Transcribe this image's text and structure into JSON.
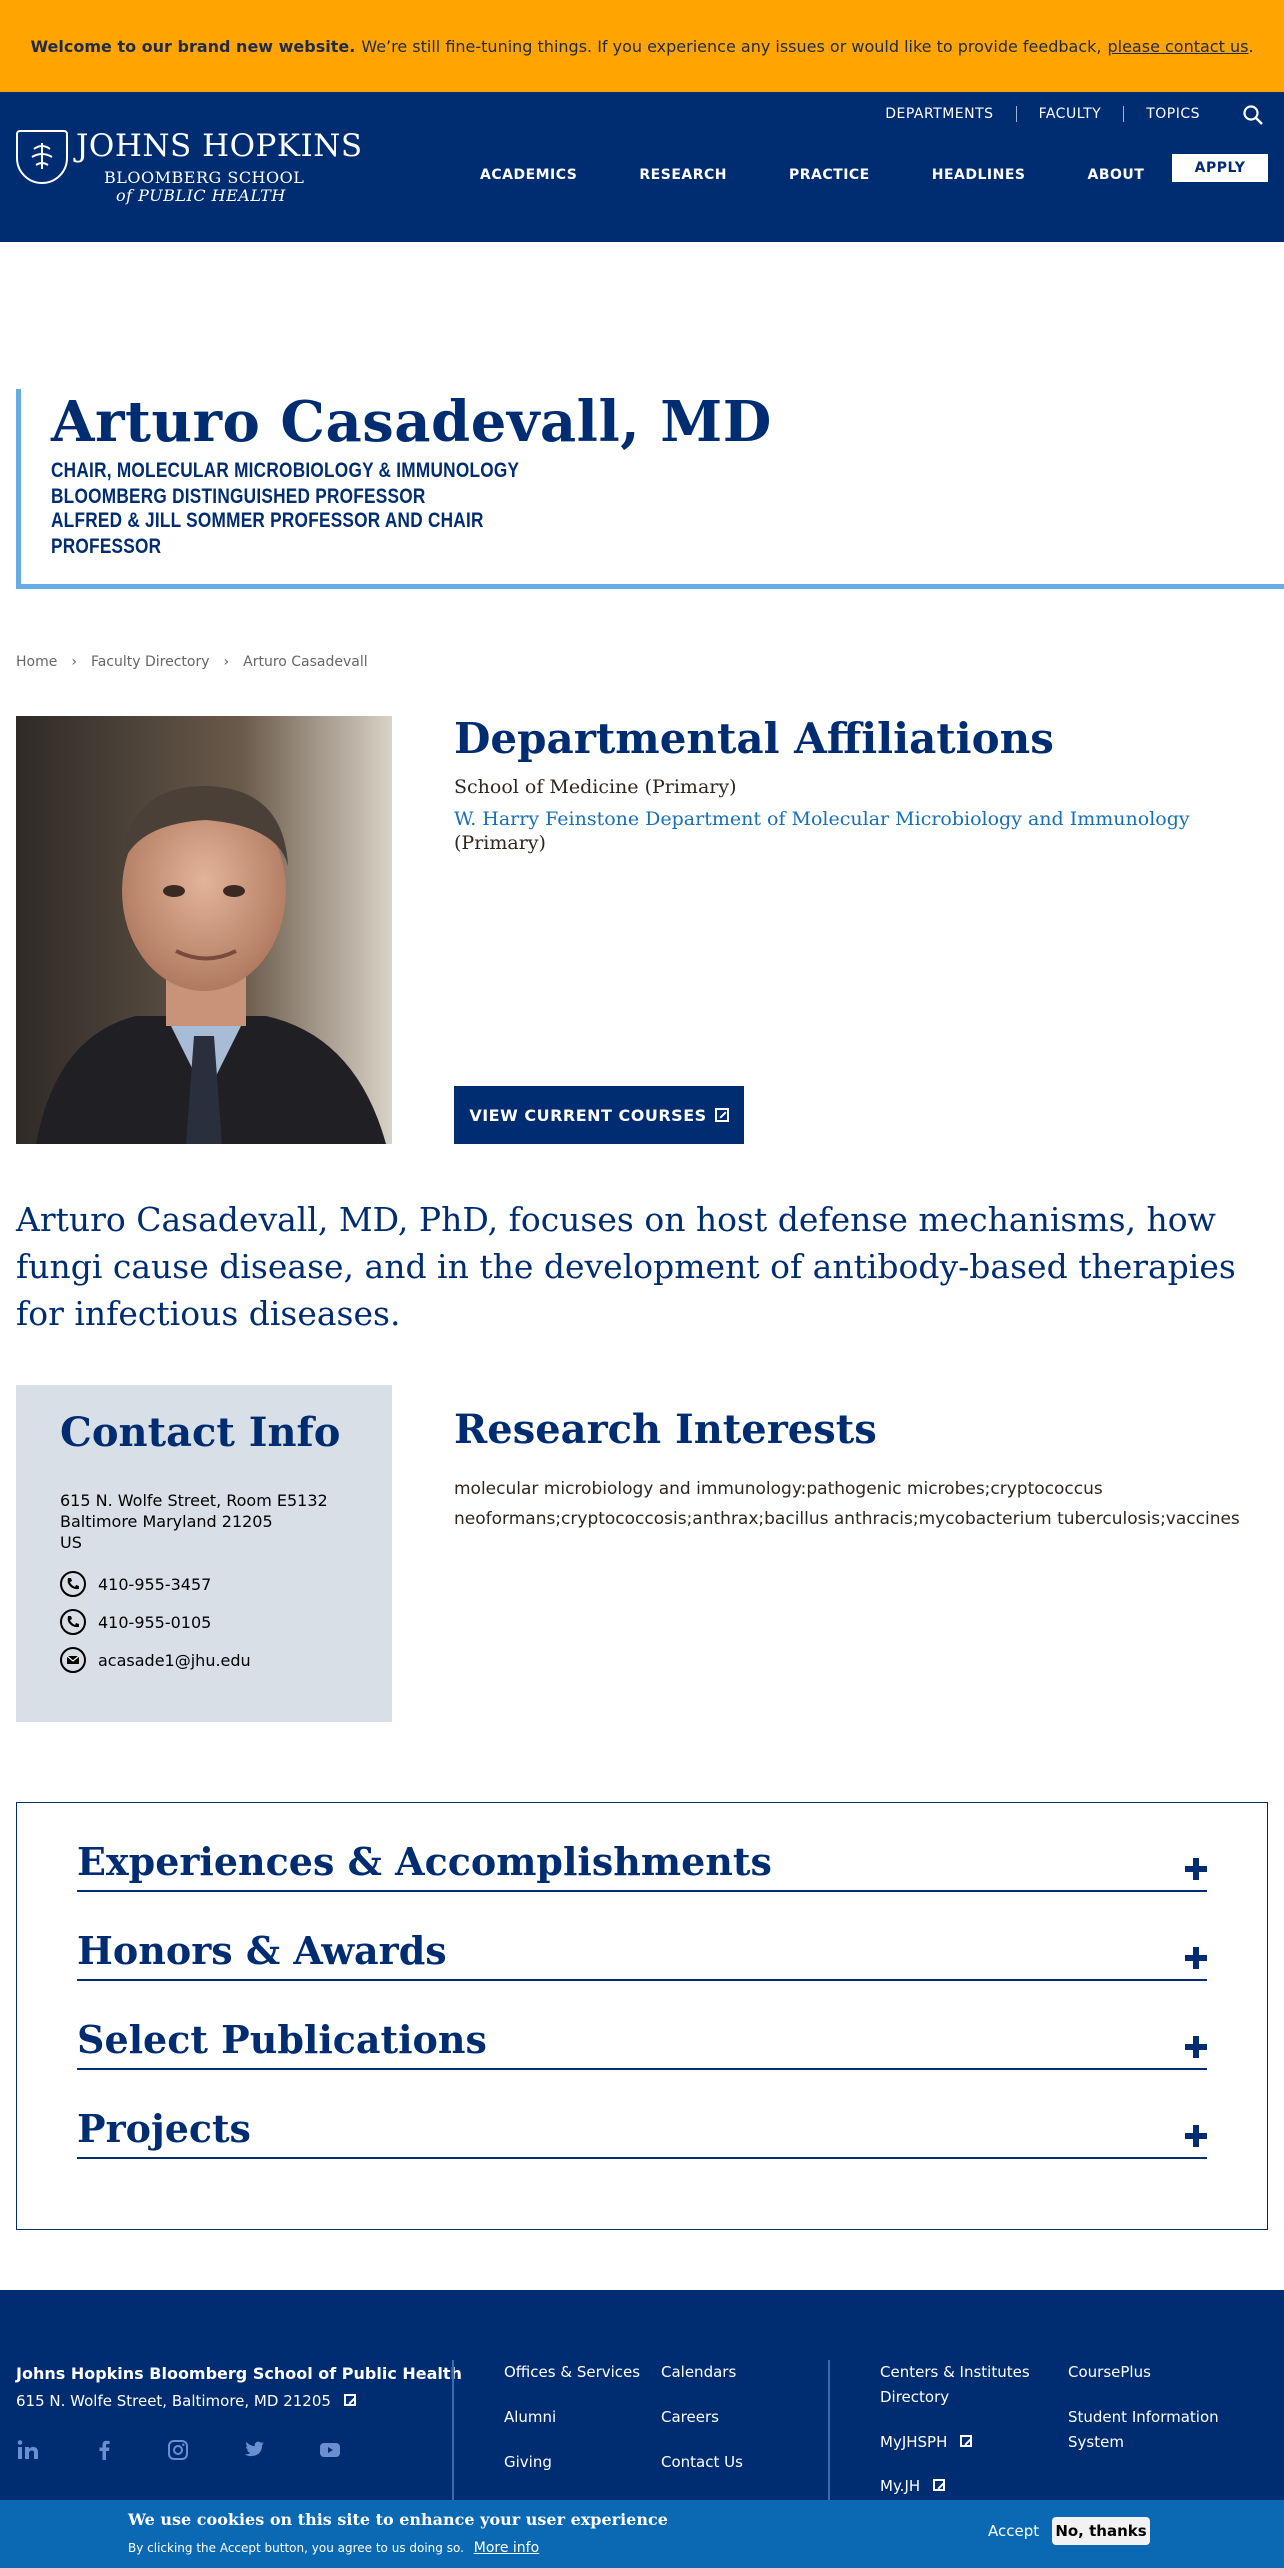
{
  "banner": {
    "bold": "Welcome to our brand new website.",
    "text": "We’re still fine-tuning things. If you experience any issues or would like to provide feedback,",
    "link": "please contact us",
    "end": "."
  },
  "header": {
    "logo_line1": "JOHNS HOPKINS",
    "logo_line2": "BLOOMBERG SCHOOL",
    "logo_line3": "of PUBLIC HEALTH",
    "top_links": [
      "DEPARTMENTS",
      "FACULTY",
      "TOPICS"
    ],
    "nav": [
      "ACADEMICS",
      "RESEARCH",
      "PRACTICE",
      "HEADLINES",
      "ABOUT"
    ],
    "apply": "APPLY"
  },
  "profile": {
    "name": "Arturo Casadevall, MD",
    "roles": [
      "CHAIR, MOLECULAR MICROBIOLOGY & IMMUNOLOGY",
      "BLOOMBERG DISTINGUISHED PROFESSOR",
      "ALFRED & JILL SOMMER PROFESSOR AND CHAIR",
      "PROFESSOR"
    ]
  },
  "breadcrumb": [
    "Home",
    "Faculty Directory",
    "Arturo Casadevall"
  ],
  "affiliations": {
    "heading": "Departmental Affiliations",
    "line1": "School of Medicine (Primary)",
    "line2_link": "W. Harry Feinstone Department of Molecular Microbiology and Immunology",
    "line2_suffix": "(Primary)",
    "courses_button": "VIEW CURRENT COURSES"
  },
  "summary": "Arturo Casadevall, MD, PhD, focuses on host defense mechanisms, how fungi cause disease, and in the development of antibody-based therapies for infectious diseases.",
  "contact": {
    "heading": "Contact Info",
    "address1": "615 N. Wolfe Street, Room E5132",
    "address2": "Baltimore  Maryland  21205",
    "address3": "US",
    "phone1": "410-955-3457",
    "phone2": "410-955-0105",
    "email": "acasade1@jhu.edu"
  },
  "research": {
    "heading": "Research Interests",
    "text": "molecular microbiology and immunology:pathogenic microbes;cryptococcus neoformans;cryptococcosis;anthrax;bacillus anthracis;mycobacterium tuberculosis;vaccines"
  },
  "accordion": [
    "Experiences & Accomplishments",
    "Honors & Awards",
    "Select Publications",
    "Projects"
  ],
  "footer": {
    "school": "Johns Hopkins Bloomberg School of Public Health",
    "address": "615 N. Wolfe Street, Baltimore, MD 21205",
    "social_icons": [
      "linkedin-icon",
      "facebook-icon",
      "instagram-icon",
      "twitter-icon",
      "youtube-icon"
    ],
    "col1": [
      "Offices & Services",
      "Alumni",
      "Giving"
    ],
    "col2": [
      "Calendars",
      "Careers",
      "Contact Us"
    ],
    "col3": [
      "Centers & Institutes Directory",
      "MyJHSPH",
      "My.JH"
    ],
    "col4": [
      "CoursePlus",
      "Student Information System"
    ]
  },
  "cookie": {
    "heading": "We use cookies on this site to enhance your user experience",
    "sub": "By clicking the Accept button, you agree to us doing so.",
    "more": "More info",
    "accept": "Accept",
    "no": "No, thanks"
  },
  "colors": {
    "brand_navy": "#002d72",
    "banner_orange": "#ffa401",
    "accent_blue": "#68ace5",
    "link_blue": "#1570b8",
    "cookie_blue": "#0b69b4"
  }
}
